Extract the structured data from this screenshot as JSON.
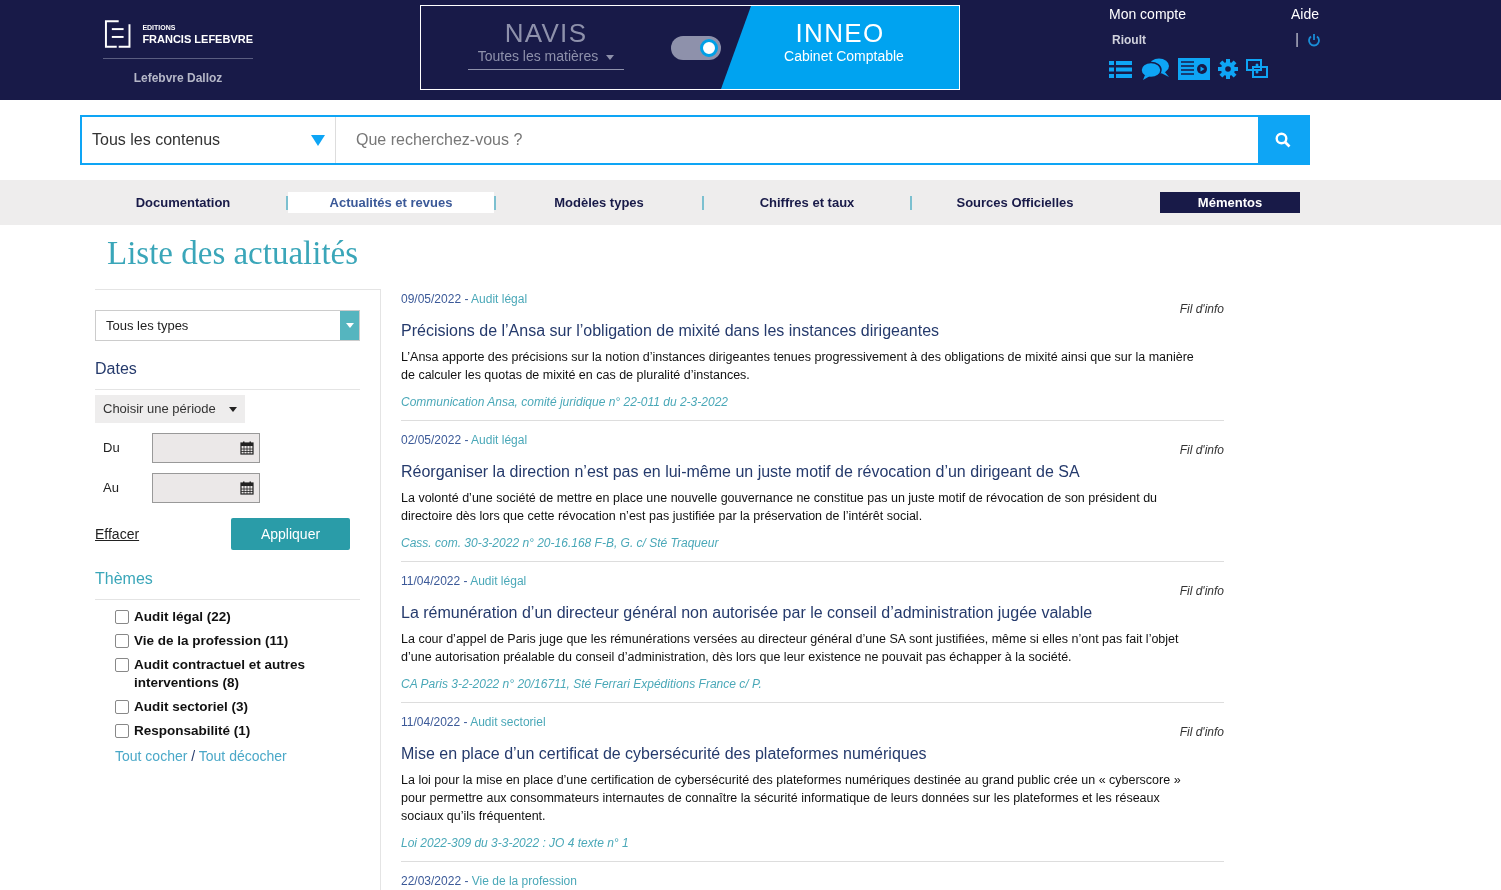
{
  "brand": {
    "small": "EDITIONS",
    "name": "FRANCIS LEFEBVRE",
    "group": "Lefebvre Dalloz"
  },
  "switcher": {
    "left_title": "NAVIS",
    "left_subtitle": "Toutes les matières",
    "right_title": "INNEO",
    "right_subtitle": "Cabinet Comptable",
    "on": true
  },
  "account": {
    "link": "Mon compte",
    "help": "Aide",
    "user": "Rioult",
    "separator": "|"
  },
  "search": {
    "scope": "Tous les contenus",
    "placeholder": "Que recherchez-vous ?"
  },
  "nav": [
    {
      "label": "Documentation",
      "selected": false,
      "kind": "plain"
    },
    {
      "label": "Actualités et revues",
      "selected": true,
      "kind": "plain"
    },
    {
      "label": "Modèles types",
      "selected": false,
      "kind": "plain"
    },
    {
      "label": "Chiffres et taux",
      "selected": false,
      "kind": "plain"
    },
    {
      "label": "Sources Officielles",
      "selected": false,
      "kind": "plain"
    },
    {
      "label": "Mémentos",
      "selected": false,
      "kind": "dark"
    }
  ],
  "page_title": "Liste des actualités",
  "category_dash": "-",
  "filters": {
    "type_select": "Tous les types",
    "dates_heading": "Dates",
    "period_select": "Choisir une période",
    "from_label": "Du",
    "to_label": "Au",
    "clear": "Effacer",
    "apply": "Appliquer",
    "themes_heading": "Thèmes",
    "themes": [
      {
        "label": "Audit légal (22)",
        "checked": false
      },
      {
        "label": "Vie de la profession (11)",
        "checked": false
      },
      {
        "label": "Audit contractuel et autres interventions (8)",
        "checked": false
      },
      {
        "label": "Audit sectoriel (3)",
        "checked": false
      },
      {
        "label": "Responsabilité (1)",
        "checked": false
      }
    ],
    "check_all": "Tout cocher",
    "separator": "/",
    "uncheck_all": "Tout décocher"
  },
  "articles": [
    {
      "date": "09/05/2022",
      "category": "Audit légal",
      "source_type": "Fil d'info",
      "title": "Précisions de l’Ansa sur l’obligation de mixité dans les instances dirigeantes",
      "summary": "L’Ansa apporte des précisions sur la notion d’instances dirigeantes tenues progressivement à des obligations de mixité ainsi que sur la manière de calculer les quotas de mixité en cas de pluralité d’instances.",
      "reference": "Communication Ansa, comité juridique n° 22-011 du 2-3-2022"
    },
    {
      "date": "02/05/2022",
      "category": "Audit légal",
      "source_type": "Fil d'info",
      "title": "Réorganiser la direction n’est pas en lui-même un juste motif de révocation d’un dirigeant de SA",
      "summary": "La volonté d’une société de mettre en place une nouvelle gouvernance ne constitue pas un juste motif de révocation de son président du directoire dès lors que cette révocation n’est pas justifiée par la préservation de l’intérêt social.",
      "reference": "Cass. com. 30-3-2022 n° 20-16.168 F-B, G. c/ Sté Traqueur"
    },
    {
      "date": "11/04/2022",
      "category": "Audit légal",
      "source_type": "Fil d'info",
      "title": "La rémunération d’un directeur général non autorisée par le conseil d’administration jugée valable",
      "summary": "La cour d’appel de Paris juge que les rémunérations versées au directeur général d’une SA sont justifiées, même si elles n’ont pas fait l’objet d’une autorisation préalable du conseil d’administration, dès lors que leur existence ne pouvait pas échapper à la société.",
      "reference": "CA Paris 3-2-2022 n° 20/16711, Sté Ferrari Expéditions France c/ P."
    },
    {
      "date": "11/04/2022",
      "category": "Audit sectoriel",
      "source_type": "Fil d'info",
      "title": "Mise en place d’un certificat de cybersécurité des plateformes numériques",
      "summary": "La loi pour la mise en place d’une certification de cybersécurité des plateformes numériques destinée au grand public crée un « cyberscore » pour permettre aux consommateurs internautes de connaître la sécurité informatique de leurs données sur les plateformes et les réseaux sociaux qu’ils fréquentent.",
      "reference": "Loi 2022-309 du 3-3-2022 : JO 4 texte n° 1"
    },
    {
      "date": "22/03/2022",
      "category": "Vie de la profession"
    }
  ]
}
